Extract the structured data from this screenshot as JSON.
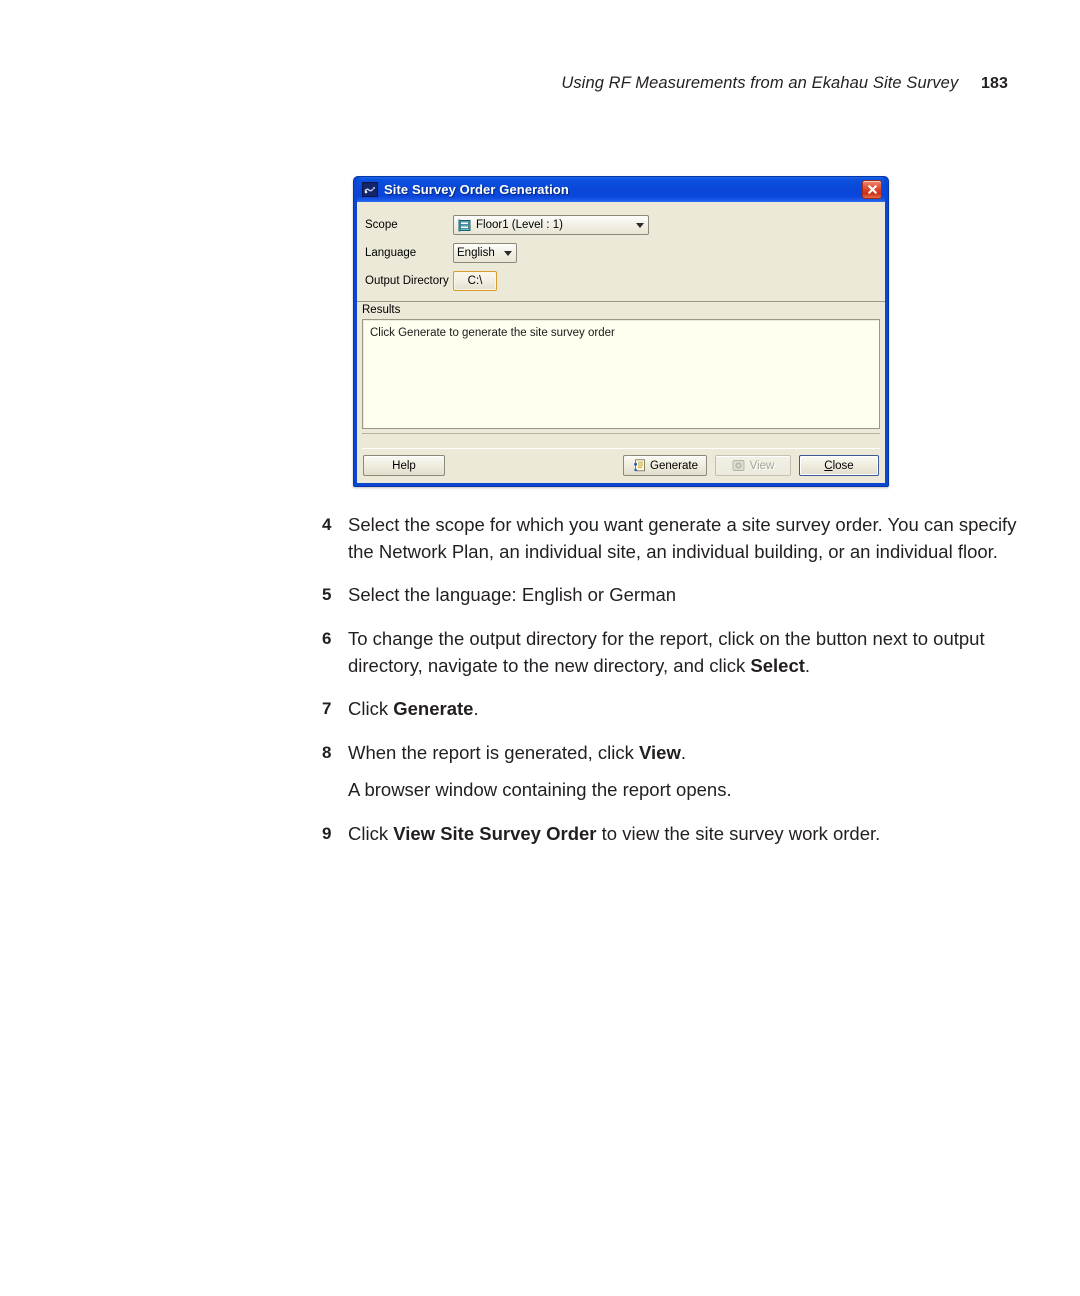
{
  "page": {
    "running_head": "Using RF Measurements from an Ekahau Site Survey",
    "page_number": "183"
  },
  "dialog": {
    "title": "Site Survey Order Generation",
    "title_icon": "app-icon",
    "close_icon": "close-icon",
    "fields": {
      "scope_label": "Scope",
      "scope_value": "Floor1 (Level : 1)",
      "scope_icon": "floor-icon",
      "language_label": "Language",
      "language_value": "English",
      "output_directory_label": "Output Directory",
      "output_directory_value": "C:\\"
    },
    "results": {
      "group_label": "Results",
      "message": "Click Generate to generate the site survey order"
    },
    "buttons": {
      "help": "Help",
      "generate": "Generate",
      "generate_icon": "report-document-icon",
      "view": "View",
      "view_icon": "view-disc-icon",
      "close": "Close"
    }
  },
  "steps": [
    {
      "number": "4",
      "html": "Select the scope for which you want generate a site survey order. You can specify the Network Plan, an individual site, an individual building, or an individual floor."
    },
    {
      "number": "5",
      "html": "Select the language: English or German"
    },
    {
      "number": "6",
      "html": "To change the output directory for the report, click on the button next to output directory, navigate to the new directory, and click <b>Select</b>."
    },
    {
      "number": "7",
      "html": "Click <b>Generate</b>."
    },
    {
      "number": "8",
      "html": "When the report is generated, click <b>View</b>."
    },
    {
      "number": "9",
      "html": "Click <b>View Site Survey Order</b> to view the site survey work order."
    }
  ],
  "step_note": "A browser window containing the report opens.",
  "colors": {
    "titlebar_blue": "#0A46D2",
    "dialog_face": "#ECE9D8",
    "results_bg": "#FFFFF0",
    "close_red": "#CC2F12",
    "focus_tan": "#D79B2E"
  }
}
